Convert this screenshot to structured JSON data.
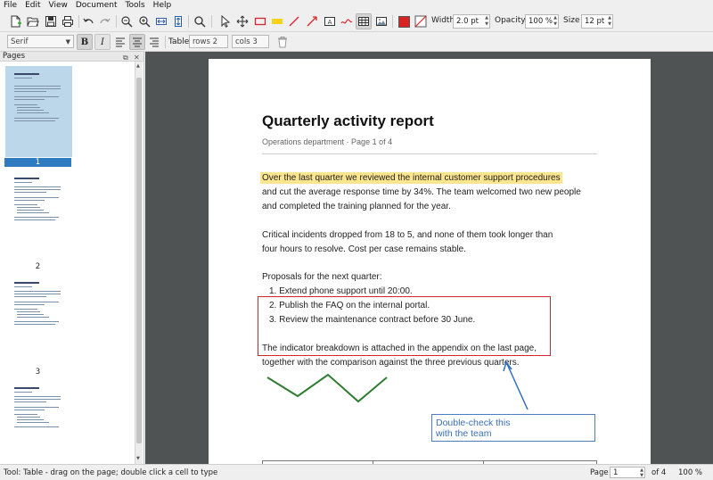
{
  "menu": [
    "File",
    "Edit",
    "View",
    "Document",
    "Tools",
    "Help"
  ],
  "toolbar": {
    "width_label": "Width",
    "width_value": "2.0 pt",
    "opacity_label": "Opacity",
    "opacity_value": "100 %",
    "size_label": "Size",
    "size_value": "12 pt",
    "stroke_color": "#d92323",
    "active_tool": "table-tool"
  },
  "format_bar": {
    "font": "Serif",
    "table_label": "Table",
    "rows": "rows 2",
    "cols": "cols 3"
  },
  "pages_panel": {
    "title": "Pages",
    "thumbnails": [
      {
        "number": "1",
        "selected": true
      },
      {
        "number": "2",
        "selected": false
      },
      {
        "number": "3",
        "selected": false
      },
      {
        "number": "",
        "selected": false
      }
    ]
  },
  "document": {
    "title": "Quarterly activity report",
    "subtitle": "Operations department  ·  Page 1 of 4",
    "p1_line1": "Over the last quarter we reviewed the internal customer support procedures",
    "p1_line2": "and cut the average response time by 34%. The team welcomed two new people",
    "p1_line3": "and completed the training planned for the year.",
    "p2_line1": "Critical incidents dropped from 18 to 5, and none of them took longer than",
    "p2_line2": "four hours to resolve. Cost per case remains stable.",
    "p3_intro": "Proposals for the next quarter:",
    "list": [
      "1. Extend phone support until 20:00.",
      "2. Publish the FAQ on the internal portal.",
      "3. Review the maintenance contract before 30 June."
    ],
    "p4_line1": "The indicator breakdown is attached in the appendix on the last page,",
    "p4_line2": "together with the comparison against the three previous quarters.",
    "note_line1": "Double-check this",
    "note_line2": "with the team",
    "highlight_color": "#fbe58e",
    "rect_color": "#d3262a",
    "arrow_color": "#2f6fc0",
    "zigzag_color": "#2e7d32"
  },
  "status": {
    "tool_text": "Tool: Table  -  drag on the page; double click a cell to type",
    "page_label": "Page",
    "page_value": "1",
    "page_total": "of 4",
    "zoom": "100 %"
  }
}
